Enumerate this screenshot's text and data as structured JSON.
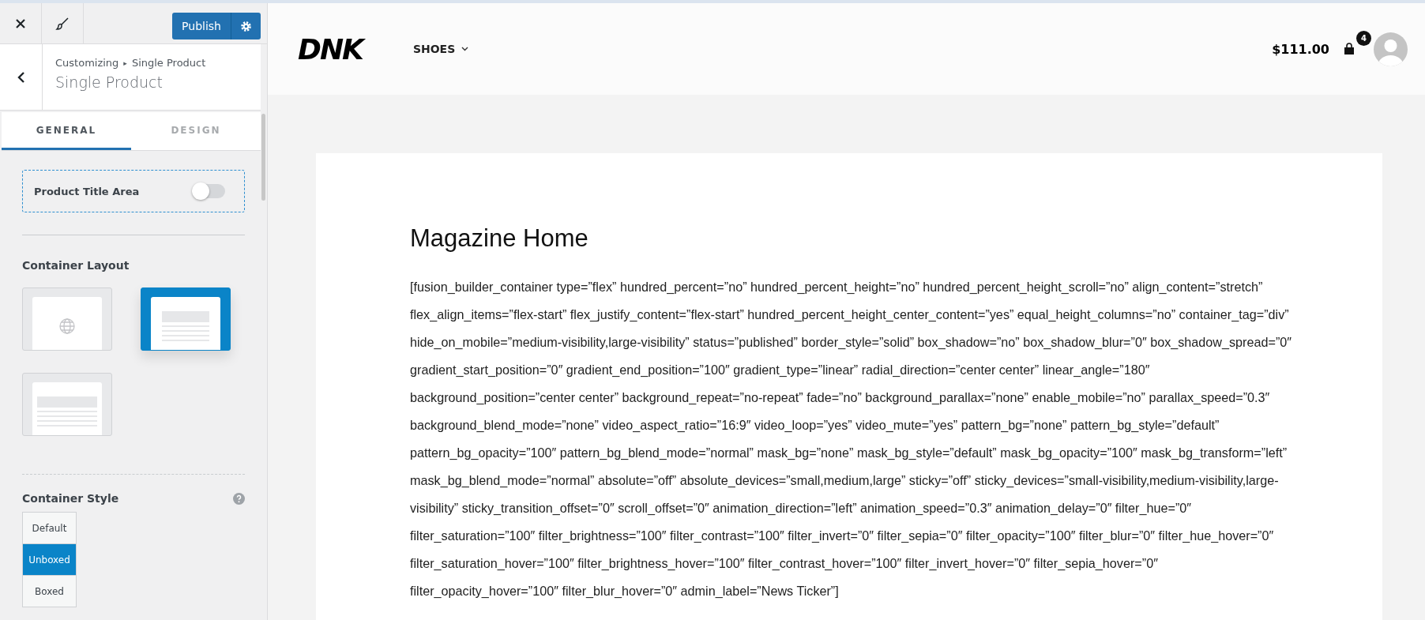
{
  "customizer": {
    "publish": {
      "label": "Publish"
    },
    "breadcrumb": {
      "parent": "Customizing",
      "separator": "▸",
      "current": "Single Product"
    },
    "title": "Single Product",
    "tabs": [
      {
        "label": "GENERAL",
        "selected": true
      },
      {
        "label": "DESIGN",
        "selected": false
      }
    ],
    "product_title_area": {
      "label": "Product Title Area",
      "on": false
    },
    "container_layout": {
      "label": "Container Layout",
      "options": [
        {
          "kind": "globe",
          "selected": false
        },
        {
          "kind": "boxed",
          "selected": true
        },
        {
          "kind": "wide",
          "selected": false
        }
      ]
    },
    "container_style": {
      "label": "Container Style",
      "options": [
        {
          "label": "Default",
          "selected": false
        },
        {
          "label": "Unboxed",
          "selected": true
        },
        {
          "label": "Boxed",
          "selected": false
        }
      ]
    }
  },
  "site": {
    "logo": "DNK",
    "nav": [
      {
        "label": "SHOES"
      }
    ],
    "cart_total": "$111.00",
    "cart_count": "4"
  },
  "page": {
    "title": "Magazine Home",
    "body": "[fusion_builder_container type=”flex” hundred_percent=”no” hundred_percent_height=”no” hundred_percent_height_scroll=”no” align_content=”stretch” flex_align_items=”flex-start” flex_justify_content=”flex-start” hundred_percent_height_center_content=”yes” equal_height_columns=”no” container_tag=”div” hide_on_mobile=”medium-visibility,large-visibility” status=”published” border_style=”solid” box_shadow=”no” box_shadow_blur=”0″ box_shadow_spread=”0″ gradient_start_position=”0″ gradient_end_position=”100″ gradient_type=”linear” radial_direction=”center center” linear_angle=”180″ background_position=”center center” background_repeat=”no-repeat” fade=”no” background_parallax=”none” enable_mobile=”no” parallax_speed=”0.3″ background_blend_mode=”none” video_aspect_ratio=”16:9″ video_loop=”yes” video_mute=”yes” pattern_bg=”none” pattern_bg_style=”default” pattern_bg_opacity=”100″ pattern_bg_blend_mode=”normal” mask_bg=”none” mask_bg_style=”default” mask_bg_opacity=”100″ mask_bg_transform=”left” mask_bg_blend_mode=”normal” absolute=”off” absolute_devices=”small,medium,large” sticky=”off” sticky_devices=”small-visibility,medium-visibility,large-visibility” sticky_transition_offset=”0″ scroll_offset=”0″ animation_direction=”left” animation_speed=”0.3″ animation_delay=”0″ filter_hue=”0″ filter_saturation=”100″ filter_brightness=”100″ filter_contrast=”100″ filter_invert=”0″ filter_sepia=”0″ filter_opacity=”100″ filter_blur=”0″ filter_hue_hover=”0″ filter_saturation_hover=”100″ filter_brightness_hover=”100″ filter_contrast_hover=”100″ filter_invert_hover=”0″ filter_sepia_hover=”0″ filter_opacity_hover=”100″ filter_blur_hover=”0″ admin_label=”News Ticker”]"
  }
}
